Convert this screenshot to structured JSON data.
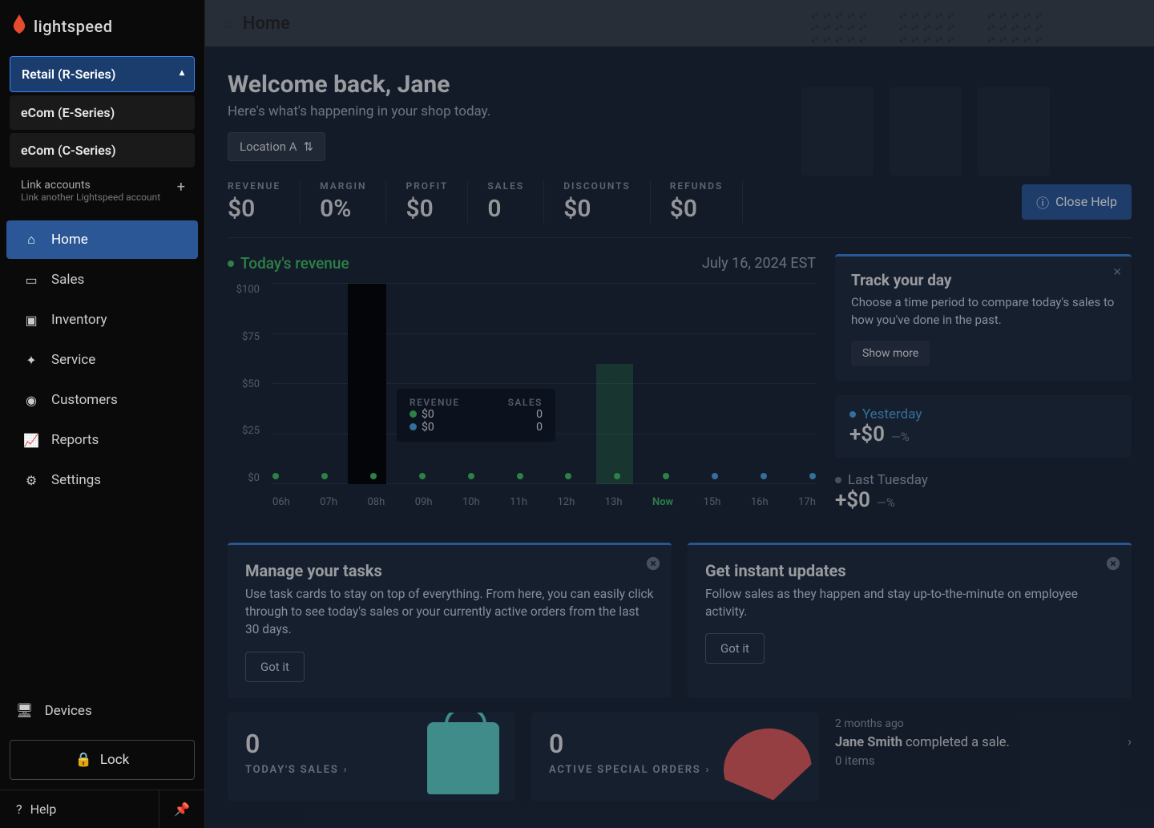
{
  "brand": "lightspeed",
  "accounts": {
    "active": "Retail (R-Series)",
    "others": [
      "eCom (E-Series)",
      "eCom (C-Series)"
    ],
    "link_title": "Link accounts",
    "link_sub": "Link another Lightspeed account"
  },
  "nav": {
    "home": "Home",
    "sales": "Sales",
    "inventory": "Inventory",
    "service": "Service",
    "customers": "Customers",
    "reports": "Reports",
    "settings": "Settings",
    "devices": "Devices",
    "lock": "Lock",
    "help": "Help"
  },
  "crumb": "Home",
  "hero": {
    "welcome": "Welcome back, Jane",
    "sub": "Here's what's happening in your shop today.",
    "location": "Location A"
  },
  "kpis": {
    "revenue_l": "REVENUE",
    "revenue_v": "$0",
    "margin_l": "MARGIN",
    "margin_v": "0%",
    "profit_l": "PROFIT",
    "profit_v": "$0",
    "sales_l": "SALES",
    "sales_v": "0",
    "discounts_l": "DISCOUNTS",
    "discounts_v": "$0",
    "refunds_l": "REFUNDS",
    "refunds_v": "$0"
  },
  "close_help": "Close Help",
  "chart": {
    "title": "Today's revenue",
    "date": "July 16, 2024 EST",
    "tooltip": {
      "rev_l": "REVENUE",
      "rev_v": "$0",
      "sales_l": "SALES",
      "sales_v": "0",
      "rev2_v": "$0",
      "sales2_v": "0"
    }
  },
  "chart_data": {
    "type": "line",
    "title": "Today's revenue",
    "ylabel": "",
    "xlabel": "",
    "ylim": [
      0,
      100
    ],
    "y_ticks": [
      "$100",
      "$75",
      "$50",
      "$25",
      "$0"
    ],
    "x_ticks": [
      "06h",
      "07h",
      "08h",
      "09h",
      "10h",
      "11h",
      "12h",
      "13h",
      "Now",
      "15h",
      "16h",
      "17h"
    ],
    "series": [
      {
        "name": "Today",
        "color": "#3fbf5f",
        "x": [
          "06h",
          "07h",
          "08h",
          "09h",
          "10h",
          "11h",
          "12h",
          "13h",
          "Now"
        ],
        "values": [
          0,
          0,
          0,
          0,
          0,
          0,
          0,
          0,
          0
        ]
      },
      {
        "name": "Yesterday",
        "color": "#4aa3df",
        "x": [
          "Now",
          "15h",
          "16h",
          "17h"
        ],
        "values": [
          0,
          0,
          0,
          0
        ]
      }
    ]
  },
  "track": {
    "title": "Track your day",
    "body": "Choose a time period to compare today's sales to how you've done in the past.",
    "show_more": "Show more"
  },
  "compare": {
    "yesterday_l": "Yesterday",
    "yesterday_v": "+$0",
    "yesterday_pct": "—%",
    "lasttue_l": "Last Tuesday",
    "lasttue_v": "+$0",
    "lasttue_pct": "—%"
  },
  "tips": {
    "manage_title": "Manage your tasks",
    "manage_body": "Use task cards to stay on top of everything. From here, you can easily click through to see today's sales or your currently active orders from the last 30 days.",
    "updates_title": "Get instant updates",
    "updates_body": "Follow sales as they happen and stay up-to-the-minute on employee activity.",
    "got_it": "Got it"
  },
  "stats": {
    "todays_sales_v": "0",
    "todays_sales_l": "TODAY'S SALES",
    "active_orders_v": "0",
    "active_orders_l": "ACTIVE SPECIAL ORDERS"
  },
  "activity": {
    "time": "2 months ago",
    "actor": "Jane Smith",
    "action": " completed a sale.",
    "items": "0 items"
  }
}
